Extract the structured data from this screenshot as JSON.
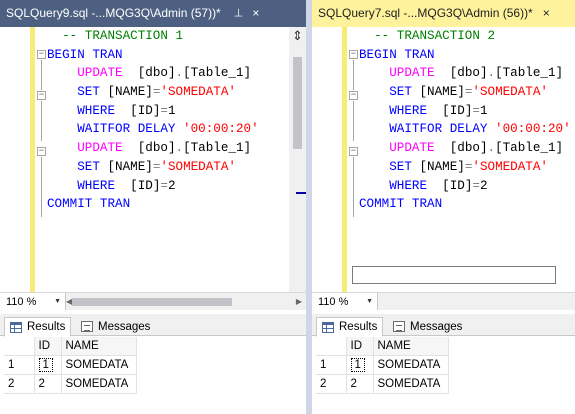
{
  "left_window": {
    "tab_title": "SQLQuery9.sql -...MQG3Q\\Admin (57))*",
    "tab_pin": "⊣",
    "tab_close": "×",
    "splitter_glyph": "⇕",
    "code_lines": [
      [
        {
          "t": "  -- TRANSACTION 1",
          "c": "kw-green"
        }
      ],
      [
        {
          "t": "BEGIN TRAN",
          "c": "kw-blue"
        }
      ],
      [
        {
          "t": "    ",
          "c": "kw-black"
        },
        {
          "t": "UPDATE",
          "c": "kw-pink"
        },
        {
          "t": "  [dbo]",
          "c": "kw-black"
        },
        {
          "t": ".",
          "c": "kw-gray"
        },
        {
          "t": "[Table_1]",
          "c": "kw-black"
        }
      ],
      [
        {
          "t": "    ",
          "c": "kw-black"
        },
        {
          "t": "SET",
          "c": "kw-blue"
        },
        {
          "t": " [NAME]",
          "c": "kw-black"
        },
        {
          "t": "=",
          "c": "kw-gray"
        },
        {
          "t": "'SOMEDATA'",
          "c": "kw-red"
        }
      ],
      [
        {
          "t": "    ",
          "c": "kw-black"
        },
        {
          "t": "WHERE",
          "c": "kw-blue"
        },
        {
          "t": "  [ID]",
          "c": "kw-black"
        },
        {
          "t": "=",
          "c": "kw-gray"
        },
        {
          "t": "1",
          "c": "kw-black"
        }
      ],
      [
        {
          "t": "    ",
          "c": "kw-black"
        },
        {
          "t": "WAITFOR DELAY",
          "c": "kw-blue"
        },
        {
          "t": " ",
          "c": "kw-black"
        },
        {
          "t": "'00:00:20'",
          "c": "kw-red"
        }
      ],
      [
        {
          "t": "    ",
          "c": "kw-black"
        },
        {
          "t": "UPDATE",
          "c": "kw-pink"
        },
        {
          "t": "  [dbo]",
          "c": "kw-black"
        },
        {
          "t": ".",
          "c": "kw-gray"
        },
        {
          "t": "[Table_1]",
          "c": "kw-black"
        }
      ],
      [
        {
          "t": "    ",
          "c": "kw-black"
        },
        {
          "t": "SET",
          "c": "kw-blue"
        },
        {
          "t": " [NAME]",
          "c": "kw-black"
        },
        {
          "t": "=",
          "c": "kw-gray"
        },
        {
          "t": "'SOMEDATA'",
          "c": "kw-red"
        }
      ],
      [
        {
          "t": "    ",
          "c": "kw-black"
        },
        {
          "t": "WHERE",
          "c": "kw-blue"
        },
        {
          "t": "  [ID]",
          "c": "kw-black"
        },
        {
          "t": "=",
          "c": "kw-gray"
        },
        {
          "t": "2",
          "c": "kw-black"
        }
      ],
      [
        {
          "t": "COMMIT TRAN",
          "c": "kw-blue"
        }
      ]
    ],
    "zoom": "110 %",
    "results_tab_label": "Results",
    "messages_tab_label": "Messages",
    "columns": [
      "ID",
      "NAME"
    ],
    "rows": [
      {
        "rownum": "1",
        "id": "1",
        "name": "SOMEDATA"
      },
      {
        "rownum": "2",
        "id": "2",
        "name": "SOMEDATA"
      }
    ]
  },
  "right_window": {
    "tab_title": "SQLQuery7.sql -...MQG3Q\\Admin (56))*",
    "tab_close": "×",
    "code_lines": [
      [
        {
          "t": "  -- TRANSACTION 2",
          "c": "kw-green"
        }
      ],
      [
        {
          "t": "BEGIN TRAN",
          "c": "kw-blue"
        }
      ],
      [
        {
          "t": "    ",
          "c": "kw-black"
        },
        {
          "t": "UPDATE",
          "c": "kw-pink"
        },
        {
          "t": "  [dbo]",
          "c": "kw-black"
        },
        {
          "t": ".",
          "c": "kw-gray"
        },
        {
          "t": "[Table_1]",
          "c": "kw-black"
        }
      ],
      [
        {
          "t": "    ",
          "c": "kw-black"
        },
        {
          "t": "SET",
          "c": "kw-blue"
        },
        {
          "t": " [NAME]",
          "c": "kw-black"
        },
        {
          "t": "=",
          "c": "kw-gray"
        },
        {
          "t": "'SOMEDATA'",
          "c": "kw-red"
        }
      ],
      [
        {
          "t": "    ",
          "c": "kw-black"
        },
        {
          "t": "WHERE",
          "c": "kw-blue"
        },
        {
          "t": "  [ID]",
          "c": "kw-black"
        },
        {
          "t": "=",
          "c": "kw-gray"
        },
        {
          "t": "1",
          "c": "kw-black"
        }
      ],
      [
        {
          "t": "    ",
          "c": "kw-black"
        },
        {
          "t": "WAITFOR DELAY",
          "c": "kw-blue"
        },
        {
          "t": " ",
          "c": "kw-black"
        },
        {
          "t": "'00:00:20'",
          "c": "kw-red"
        }
      ],
      [
        {
          "t": "    ",
          "c": "kw-black"
        },
        {
          "t": "UPDATE",
          "c": "kw-pink"
        },
        {
          "t": "  [dbo]",
          "c": "kw-black"
        },
        {
          "t": ".",
          "c": "kw-gray"
        },
        {
          "t": "[Table_1]",
          "c": "kw-black"
        }
      ],
      [
        {
          "t": "    ",
          "c": "kw-black"
        },
        {
          "t": "SET",
          "c": "kw-blue"
        },
        {
          "t": " [NAME]",
          "c": "kw-black"
        },
        {
          "t": "=",
          "c": "kw-gray"
        },
        {
          "t": "'SOMEDATA'",
          "c": "kw-red"
        }
      ],
      [
        {
          "t": "    ",
          "c": "kw-black"
        },
        {
          "t": "WHERE",
          "c": "kw-blue"
        },
        {
          "t": "  [ID]",
          "c": "kw-black"
        },
        {
          "t": "=",
          "c": "kw-gray"
        },
        {
          "t": "2",
          "c": "kw-black"
        }
      ],
      [
        {
          "t": "COMMIT TRAN",
          "c": "kw-blue"
        }
      ]
    ],
    "zoom": "110 %",
    "results_tab_label": "Results",
    "messages_tab_label": "Messages",
    "columns": [
      "ID",
      "NAME"
    ],
    "rows": [
      {
        "rownum": "1",
        "id": "1",
        "name": "SOMEDATA"
      },
      {
        "rownum": "2",
        "id": "2",
        "name": "SOMEDATA"
      }
    ]
  },
  "colors": {
    "inactive_tab": "#4d6082",
    "active_tab": "#fff29d",
    "gutter_yellow": "#f7ec78",
    "keyword_blue": "#0000ff",
    "keyword_pink": "#ff00ff",
    "string_red": "#ff0000",
    "comment_green": "#008000"
  }
}
